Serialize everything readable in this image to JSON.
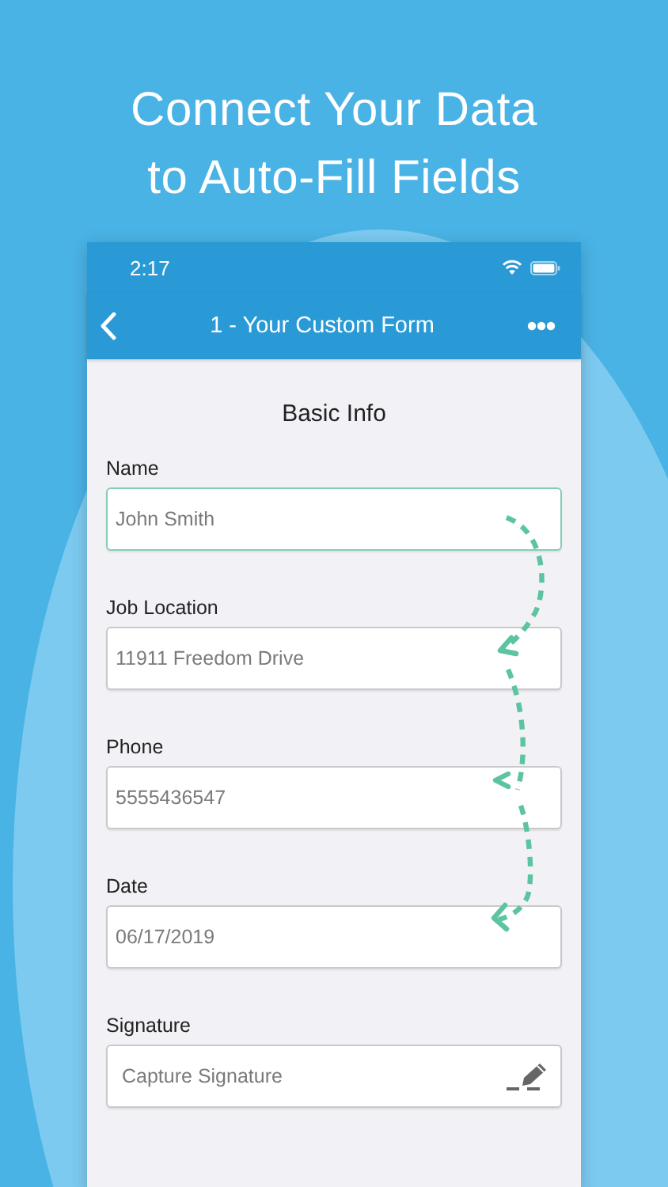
{
  "headline": [
    "Connect Your Data",
    "to Auto-Fill Fields"
  ],
  "status_bar": {
    "time": "2:17"
  },
  "nav_bar": {
    "title": "1 - Your Custom Form"
  },
  "form": {
    "section_title": "Basic Info",
    "fields": [
      {
        "kind": "text",
        "label": "Name",
        "value": "John Smith",
        "focused": true
      },
      {
        "kind": "text",
        "label": "Job Location",
        "value": "11911 Freedom Drive",
        "focused": false
      },
      {
        "kind": "text",
        "label": "Phone",
        "value": "5555436547",
        "focused": false
      },
      {
        "kind": "text",
        "label": "Date",
        "value": "06/17/2019",
        "focused": false
      },
      {
        "kind": "signature",
        "label": "Signature",
        "value": "Capture Signature",
        "focused": false
      }
    ]
  }
}
